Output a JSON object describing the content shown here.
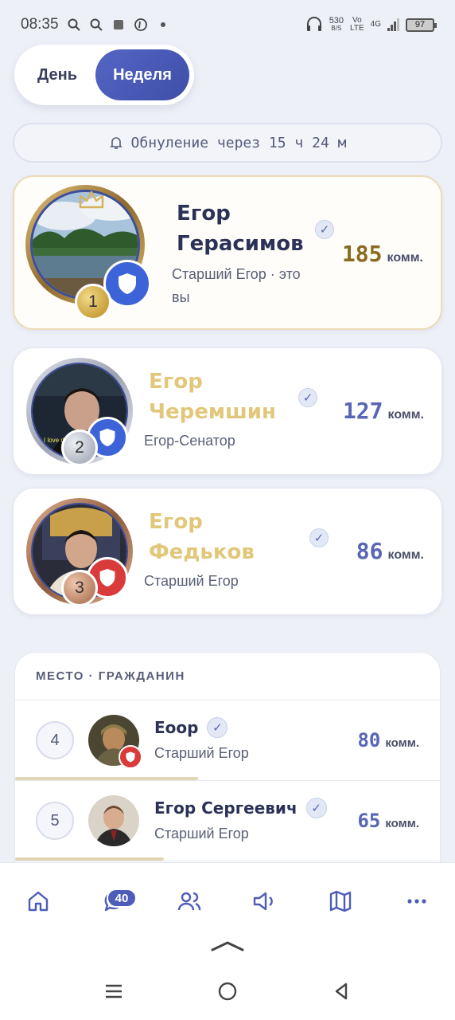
{
  "status_bar": {
    "time": "08:35",
    "net_speed_value": "530",
    "net_speed_unit": "B/S",
    "volte_top": "Vo",
    "volte_bottom": "LTE",
    "network": "4G",
    "battery": "97"
  },
  "period_toggle": {
    "day_label": "День",
    "week_label": "Неделя",
    "selected": "Неделя"
  },
  "reset_notice": "Обнуление через 15 ч 24 м",
  "podium": [
    {
      "rank": "1",
      "name_line1": "Егор",
      "name_line2": "Герасимов",
      "subtitle_line1": "Старший Егор · это",
      "subtitle_line2": "вы",
      "score": "185",
      "unit": "комм.",
      "name_color": "#2c3257",
      "score_color": "#8a6a1f",
      "shield_color": "#3d63d9",
      "medal_color": "#c9a23b"
    },
    {
      "rank": "2",
      "name_line1": "Егор",
      "name_line2": "Черемшин",
      "subtitle_line1": "Егор-Сенатор",
      "score": "127",
      "unit": "комм.",
      "name_color": "#e2c77a",
      "score_color": "#5866b5",
      "shield_color": "#3d63d9",
      "medal_color": "#b8bcc8"
    },
    {
      "rank": "3",
      "name_line1": "Егор",
      "name_line2": "Федьков",
      "subtitle_line1": "Старший Егор",
      "score": "86",
      "unit": "комм.",
      "name_color": "#e2c77a",
      "score_color": "#5866b5",
      "shield_color": "#d93a3a",
      "medal_color": "#b98264"
    }
  ],
  "list": {
    "header": "МЕСТО · ГРАЖДАНИН",
    "rows": [
      {
        "rank": "4",
        "name": "Еоор",
        "subtitle": "Старший Егор",
        "score": "80",
        "unit": "комм.",
        "progress": 0.43
      },
      {
        "rank": "5",
        "name": "Егор Сергеевич",
        "subtitle": "Старший Егор",
        "score": "65",
        "unit": "комм.",
        "progress": 0.35
      }
    ]
  },
  "bottom_nav": {
    "items": [
      {
        "icon": "home-icon"
      },
      {
        "icon": "chat-icon",
        "badge": "40"
      },
      {
        "icon": "users-icon"
      },
      {
        "icon": "speaker-icon"
      },
      {
        "icon": "map-icon"
      },
      {
        "icon": "more-icon"
      }
    ]
  },
  "colors": {
    "accent": "#4d5cb8",
    "gold_border": "#ecdcb5",
    "background": "#eef0f8"
  }
}
